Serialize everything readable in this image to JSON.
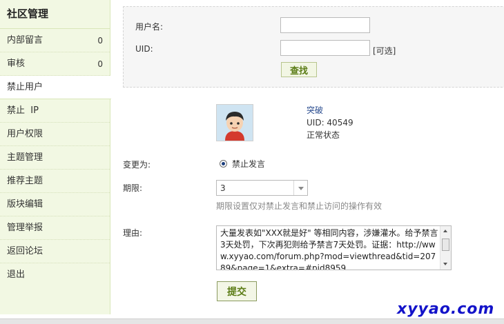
{
  "sidebar": {
    "title": "社区管理",
    "items": [
      {
        "label": "内部留言",
        "count": "0"
      },
      {
        "label": "审核",
        "count": "0"
      },
      {
        "label": "禁止用户",
        "count": ""
      },
      {
        "label": "禁止  IP",
        "count": ""
      },
      {
        "label": "用户权限",
        "count": ""
      },
      {
        "label": "主题管理",
        "count": ""
      },
      {
        "label": "推荐主题",
        "count": ""
      },
      {
        "label": "版块编辑",
        "count": ""
      },
      {
        "label": "管理举报",
        "count": ""
      },
      {
        "label": "返回论坛",
        "count": ""
      },
      {
        "label": "退出",
        "count": ""
      }
    ],
    "active_index": 2
  },
  "search": {
    "username_label": "用户名:",
    "username_value": "",
    "uid_label": "UID:",
    "uid_value": "",
    "optional_note": "[可选]",
    "find_button": "查找"
  },
  "user": {
    "name": "突破",
    "uid_line": "UID: 40549",
    "status": "正常状态",
    "avatar": "cartoon-avatar-icon"
  },
  "form": {
    "change_label": "变更为:",
    "change_option": "禁止发言",
    "period_label": "期限:",
    "period_value": "3",
    "period_hint": "期限设置仅对禁止发言和禁止访问的操作有效",
    "reason_label": "理由:",
    "reason_text": "大量发表如\"XXX就是好\" 等相同内容，涉嫌灌水。给予禁言3天处罚，下次再犯则给予禁言7天处罚。证据：http://www.xyyao.com/forum.php?mod=viewthread&tid=20789&page=1&extra=#pid8959",
    "submit_button": "提交"
  },
  "watermark": "xyyao.com",
  "colors": {
    "sidebar_bg": "#f2f8e3",
    "button_text": "#5b7c16",
    "watermark": "#1313c9"
  }
}
